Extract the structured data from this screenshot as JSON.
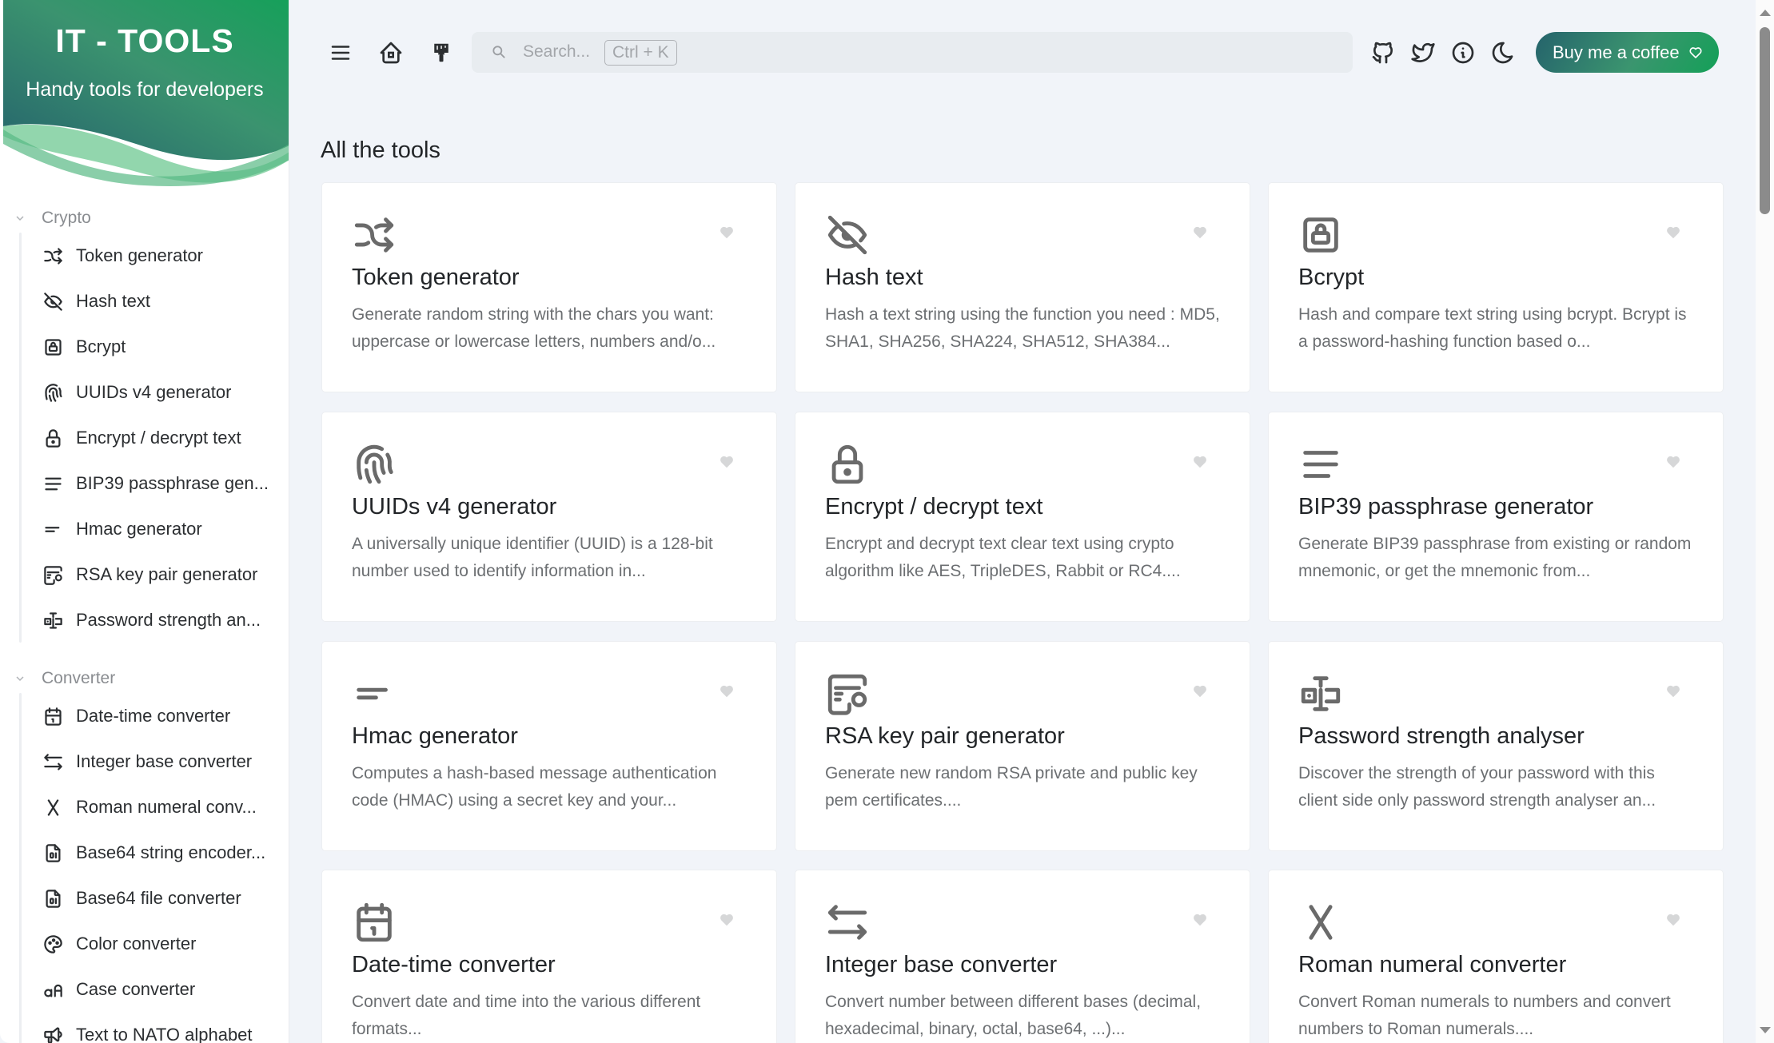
{
  "brand": {
    "title": "IT - TOOLS",
    "subtitle": "Handy tools for developers",
    "gradient_start": "#25636c",
    "gradient_end": "#14a058"
  },
  "sidebar": {
    "groups": [
      {
        "title": "Crypto",
        "items": [
          {
            "label": "Token generator",
            "icon": "shuffle-icon"
          },
          {
            "label": "Hash text",
            "icon": "eye-off-icon"
          },
          {
            "label": "Bcrypt",
            "icon": "lock-square-icon"
          },
          {
            "label": "UUIDs v4 generator",
            "icon": "fingerprint-icon"
          },
          {
            "label": "Encrypt / decrypt text",
            "icon": "lock-icon"
          },
          {
            "label": "BIP39 passphrase gen...",
            "icon": "align-justified-icon"
          },
          {
            "label": "Hmac generator",
            "icon": "short-text-icon"
          },
          {
            "label": "RSA key pair generator",
            "icon": "certificate-icon"
          },
          {
            "label": "Password strength an...",
            "icon": "password-icon"
          }
        ]
      },
      {
        "title": "Converter",
        "items": [
          {
            "label": "Date-time converter",
            "icon": "calendar-icon"
          },
          {
            "label": "Integer base converter",
            "icon": "arrows-left-right-icon"
          },
          {
            "label": "Roman numeral conv...",
            "icon": "letter-x-icon"
          },
          {
            "label": "Base64 string encoder...",
            "icon": "file-digit-icon"
          },
          {
            "label": "Base64 file converter",
            "icon": "file-digit-icon"
          },
          {
            "label": "Color converter",
            "icon": "palette-icon"
          },
          {
            "label": "Case converter",
            "icon": "letter-case-icon"
          },
          {
            "label": "Text to NATO alphabet",
            "icon": "speakerphone-icon"
          }
        ]
      }
    ]
  },
  "topbar": {
    "search_placeholder": "Search...",
    "search_shortcut": "Ctrl + K",
    "coffee_label": "Buy me a coffee"
  },
  "main": {
    "title": "All the tools",
    "tools": [
      {
        "title": "Token generator",
        "desc": "Generate random string with the chars you want: uppercase or lowercase letters, numbers and/o...",
        "icon": "shuffle-icon"
      },
      {
        "title": "Hash text",
        "desc": "Hash a text string using the function you need : MD5, SHA1, SHA256, SHA224, SHA512, SHA384...",
        "icon": "eye-off-icon"
      },
      {
        "title": "Bcrypt",
        "desc": "Hash and compare text string using bcrypt. Bcrypt is a password-hashing function based o...",
        "icon": "lock-square-icon"
      },
      {
        "title": "UUIDs v4 generator",
        "desc": "A universally unique identifier (UUID) is a 128-bit number used to identify information in...",
        "icon": "fingerprint-icon"
      },
      {
        "title": "Encrypt / decrypt text",
        "desc": "Encrypt and decrypt text clear text using crypto algorithm like AES, TripleDES, Rabbit or RC4....",
        "icon": "lock-icon"
      },
      {
        "title": "BIP39 passphrase generator",
        "desc": "Generate BIP39 passphrase from existing or random mnemonic, or get the mnemonic from...",
        "icon": "align-justified-icon"
      },
      {
        "title": "Hmac generator",
        "desc": "Computes a hash-based message authentication code (HMAC) using a secret key and your...",
        "icon": "short-text-icon"
      },
      {
        "title": "RSA key pair generator",
        "desc": "Generate new random RSA private and public key pem certificates....",
        "icon": "certificate-icon"
      },
      {
        "title": "Password strength analyser",
        "desc": "Discover the strength of your password with this client side only password strength analyser an...",
        "icon": "password-icon"
      },
      {
        "title": "Date-time converter",
        "desc": "Convert date and time into the various different formats...",
        "icon": "calendar-icon"
      },
      {
        "title": "Integer base converter",
        "desc": "Convert number between different bases (decimal, hexadecimal, binary, octal, base64, ...)...",
        "icon": "arrows-left-right-icon"
      },
      {
        "title": "Roman numeral converter",
        "desc": "Convert Roman numerals to numbers and convert numbers to Roman numerals....",
        "icon": "letter-x-icon"
      }
    ]
  }
}
